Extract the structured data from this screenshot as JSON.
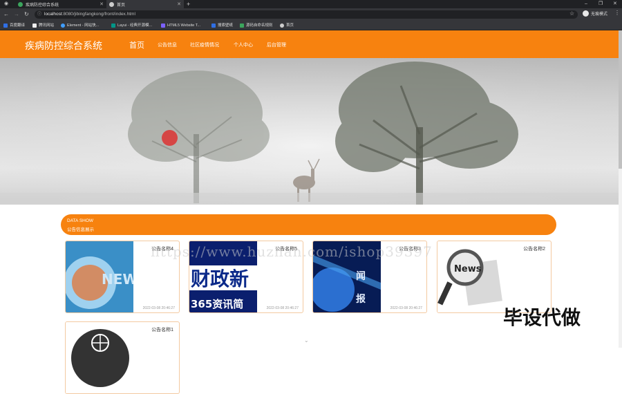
{
  "browser": {
    "tabs": [
      {
        "label": "疾病防控综合系统",
        "icon_color": "#3ba55d"
      },
      {
        "label": "首页",
        "icon_color": "#cccccc"
      }
    ],
    "window_controls": [
      "–",
      "❐",
      "✕"
    ],
    "url_host": "localhost",
    "url_rest": ":8080/jibingfangkong/front/index.html",
    "profile_label": "无痕模式",
    "bookmarks": [
      {
        "label": "百度翻译",
        "color": "#2f6fe4"
      },
      {
        "label": "腾讯网站",
        "color": "#eeeeee"
      },
      {
        "label": "Element - 网站快...",
        "color": "#409eff"
      },
      {
        "label": "Layui - 经典开源模...",
        "color": "#009688"
      },
      {
        "label": "HTML5 Website T...",
        "color": "#7b61ff"
      },
      {
        "label": "搜索壁纸",
        "color": "#2f6fe4"
      },
      {
        "label": "源码自命名规则",
        "color": "#3ba55d"
      },
      {
        "label": "首页",
        "color": "#cccccc"
      }
    ]
  },
  "site": {
    "brand": "疾病防控综合系统",
    "nav": [
      "首页",
      "公告信息",
      "社区疫情情况",
      "个人中心",
      "后台管理"
    ],
    "accent": "#f7820f"
  },
  "carousel": {
    "slide_count": 3,
    "active_index": 0
  },
  "section": {
    "title_en": "DATA SHOW",
    "title_cn": "公告信息展示"
  },
  "cards": [
    {
      "title": "公告名称4",
      "date": "2022-03-08 20:46:27",
      "image": "news-globe-image"
    },
    {
      "title": "公告名称5",
      "date": "2022-03-08 20:46:27",
      "image": "finance-news-image"
    },
    {
      "title": "公告名称3",
      "date": "2022-03-08 20:46:27",
      "image": "news-report-image"
    },
    {
      "title": "公告名称2",
      "date": "",
      "image": "news-magnifier-image"
    },
    {
      "title": "公告名称1",
      "date": "",
      "image": "globe-icon-image"
    }
  ],
  "watermark": {
    "url": "https://www.huzhan.com/ishop39397",
    "cn": "毕设代做"
  }
}
